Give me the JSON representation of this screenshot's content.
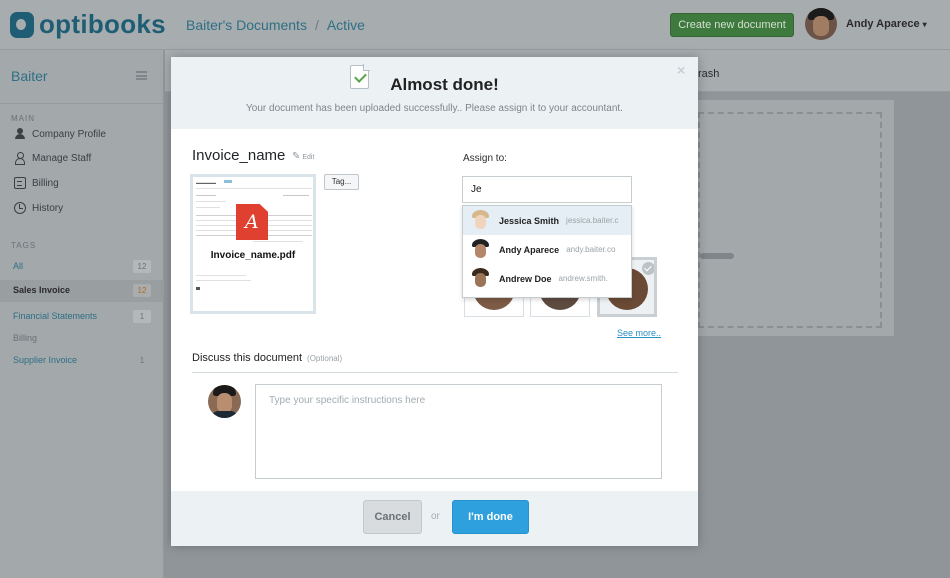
{
  "app": {
    "logo_text": "optibooks",
    "brand_color": "#1f5d74",
    "breadcrumb": {
      "folder": "Baiter's Documents",
      "separator": "/",
      "current": "Active"
    },
    "create_button_label": "Create new document",
    "user": {
      "name": "Andy Aparece",
      "caret": "▾"
    }
  },
  "sidebar": {
    "title": "Baiter",
    "main_heading": "MAIN",
    "items": [
      {
        "label": "Company Profile",
        "icon": "person-icon"
      },
      {
        "label": "Manage Staff",
        "icon": "staff-icon"
      },
      {
        "label": "Billing",
        "icon": "billing-icon"
      },
      {
        "label": "History",
        "icon": "history-icon"
      }
    ],
    "tags_heading": "TAGS",
    "tags": [
      {
        "label": "All",
        "count": "12"
      },
      {
        "label": "Sales Invoice",
        "count": "12"
      },
      {
        "label": "Financial Statements",
        "count": "1"
      },
      {
        "label": "Billing",
        "count": ""
      },
      {
        "label": "Supplier Invoice",
        "count": "1"
      }
    ]
  },
  "main": {
    "trash_label": "rash"
  },
  "modal": {
    "title": "Almost done!",
    "subtitle": "Your document has been uploaded successfully.. Please assign it to your accountant.",
    "close_glyph": "×",
    "file_name": "Invoice_name",
    "edit_label": "Edit",
    "preview_filename": "Invoice_name.pdf",
    "tag_button_label": "Tag...",
    "assign_label": "Assign to:",
    "assign_input_value": "Je",
    "suggestions": [
      {
        "name": "Jessica Smith",
        "email": "jessica.baiter.c"
      },
      {
        "name": "Andy Aparece",
        "email": "andy.baiter.co"
      },
      {
        "name": "Andrew Doe",
        "email": "andrew.smith."
      }
    ],
    "see_more_label": "See more..",
    "discuss_label": "Discuss this document",
    "optional_label": "(Optional)",
    "instructions_placeholder": "Type your specific instructions here",
    "cancel_label": "Cancel",
    "or_label": "or",
    "done_label": "I'm done",
    "accent_color": "#2ea0dd"
  }
}
